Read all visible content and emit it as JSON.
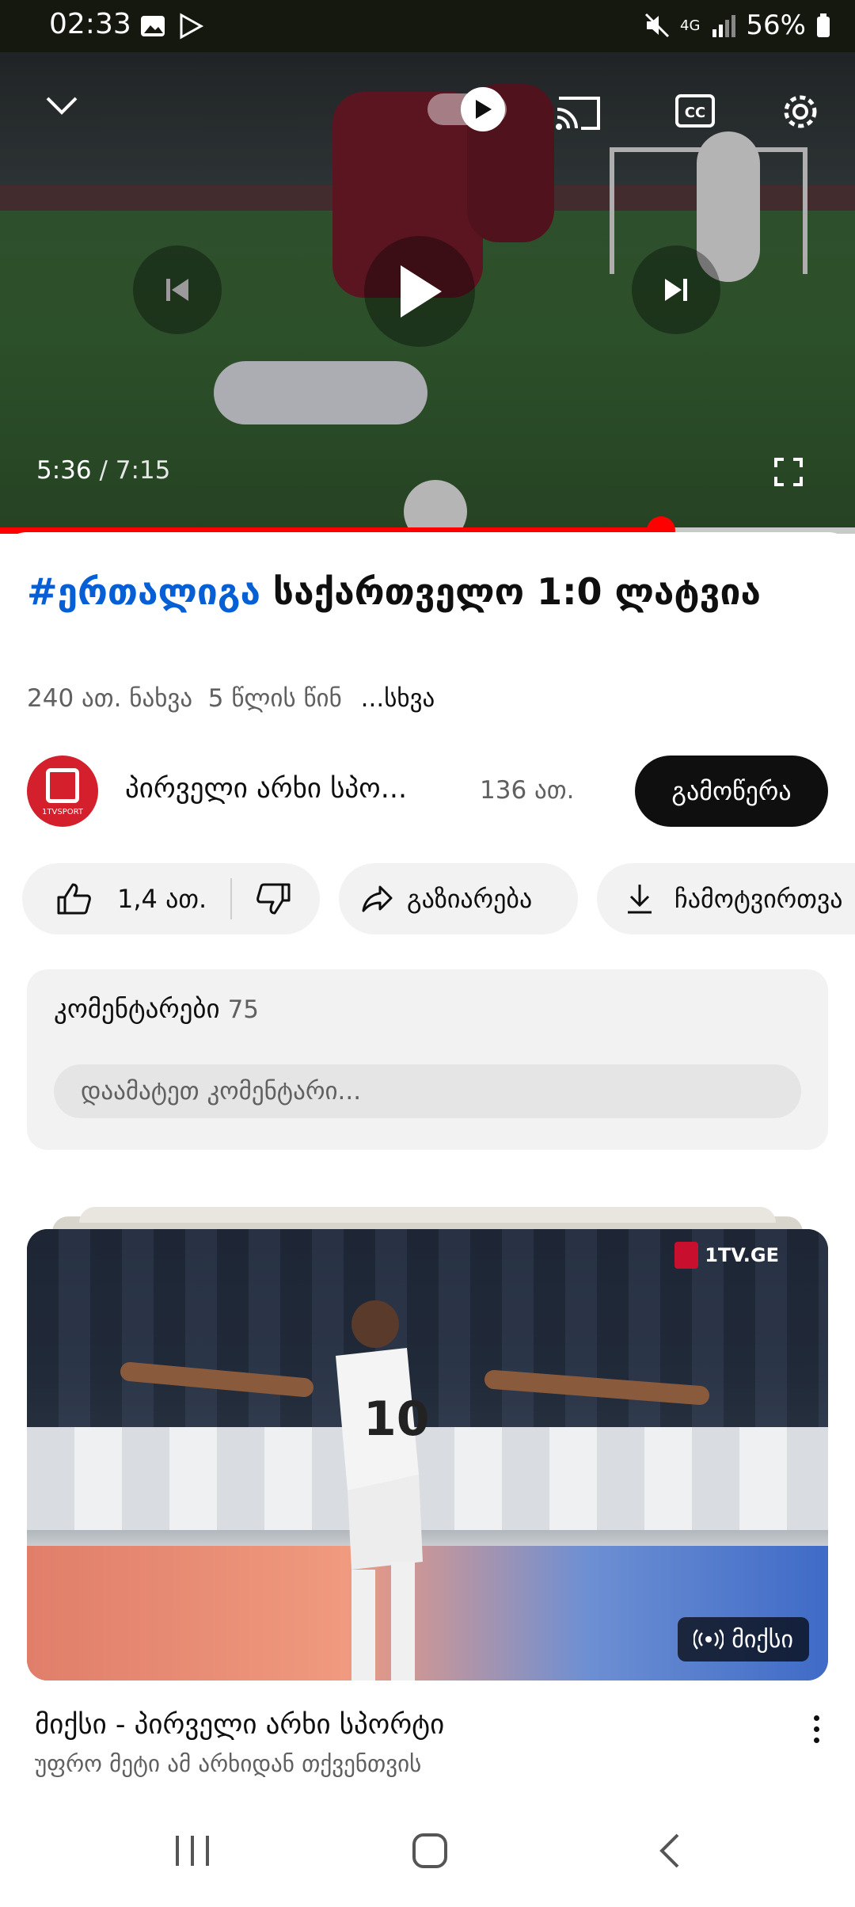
{
  "status_bar": {
    "time": "02:33",
    "battery": "56%",
    "network": "4G"
  },
  "player": {
    "current_time": "5:36",
    "separator": " / ",
    "duration": "7:15",
    "progress_fraction": 0.773
  },
  "video": {
    "hashtag": "#ერთალიგა",
    "title": " საქართველო 1:0 ლატვია",
    "views": "240 ათ. ნახვა",
    "age": "5 წლის წინ",
    "more": "...სხვა"
  },
  "channel": {
    "name": "პირველი არხი სპო...",
    "subscribers": "136 ათ.",
    "subscribe_label": "გამოწერა",
    "avatar_text": "1TVSPORT"
  },
  "actions": {
    "likes": "1,4 ათ.",
    "share": "გაზიარება",
    "download": "ჩამოტვირთვა"
  },
  "comments": {
    "title": "კომენტარები",
    "count": "75",
    "placeholder": "დაამატეთ კომენტარი..."
  },
  "mix": {
    "badge": "მიქსი",
    "title": "მიქსი - პირველი არხი სპორტი",
    "subtitle": "უფრო მეტი ამ არხიდან თქვენთვის",
    "watermark": "1TV.GE"
  }
}
